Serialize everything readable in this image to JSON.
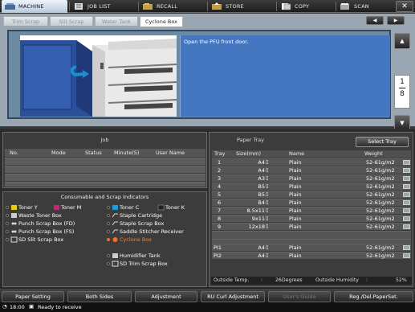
{
  "topnav": {
    "tabs": [
      {
        "label": "MACHINE",
        "icon": "machine-icon"
      },
      {
        "label": "JOB LIST",
        "icon": "job-list-icon"
      },
      {
        "label": "RECALL",
        "icon": "recall-icon"
      },
      {
        "label": "STORE",
        "icon": "store-icon"
      },
      {
        "label": "COPY",
        "icon": "copy-icon"
      },
      {
        "label": "SCAN",
        "icon": "scan-icon"
      }
    ],
    "close_label": "✕"
  },
  "subtabs": [
    "Trim Scrap",
    "Slit Scrap",
    "Water Tank",
    "Cyclone Box"
  ],
  "guide": {
    "message": "Open the PFU front door.",
    "page_current": "1",
    "page_total": "8"
  },
  "job": {
    "title": "Job",
    "columns": [
      "No.",
      "Mode",
      "Status",
      "Minute(S)",
      "User Name"
    ]
  },
  "consumables": {
    "title": "Consumable and Scrap Indicators",
    "items": [
      {
        "label": "Toner Y",
        "color": "#e8d000"
      },
      {
        "label": "Toner M",
        "color": "#d0207a"
      },
      {
        "label": "Toner C",
        "color": "#1aa0d8"
      },
      {
        "label": "Toner K",
        "color": "#111111"
      },
      {
        "label": "Waste Toner Box"
      },
      {
        "label": "Staple Cartridge"
      },
      {
        "label": "Punch Scrap Box (FD)"
      },
      {
        "label": "Staple Scrap Box"
      },
      {
        "label": "Punch Scrap Box (FS)"
      },
      {
        "label": "Saddle Stitcher Receiver"
      },
      {
        "label": "SD Slit Scrap Box"
      },
      {
        "label": "Cyclone Box",
        "warning": true
      },
      {
        "label": "Humidifier Tank"
      },
      {
        "label": "SD Trim Scrap Box"
      }
    ]
  },
  "paper_tray": {
    "title": "Paper Tray",
    "select_label": "Select Tray",
    "columns": [
      "Tray",
      "Size(mm)",
      "Name",
      "Weight"
    ],
    "rows": [
      {
        "tray": "1",
        "size": "A4",
        "name": "Plain",
        "weight": "52-61g/m2"
      },
      {
        "tray": "2",
        "size": "A4",
        "name": "Plain",
        "weight": "52-61g/m2"
      },
      {
        "tray": "3",
        "size": "A3",
        "name": "Plain",
        "weight": "52-61g/m2"
      },
      {
        "tray": "4",
        "size": "B5",
        "name": "Plain",
        "weight": "52-61g/m2"
      },
      {
        "tray": "5",
        "size": "B5",
        "name": "Plain",
        "weight": "52-61g/m2"
      },
      {
        "tray": "6",
        "size": "B4",
        "name": "Plain",
        "weight": "52-61g/m2"
      },
      {
        "tray": "7",
        "size": "8.5x11",
        "name": "Plain",
        "weight": "52-61g/m2"
      },
      {
        "tray": "8",
        "size": "9x11",
        "name": "Plain",
        "weight": "52-61g/m2"
      },
      {
        "tray": "9",
        "size": "12x18",
        "name": "Plain",
        "weight": "52-61g/m2"
      },
      {
        "tray": "PI1",
        "size": "A4",
        "name": "Plain",
        "weight": "52-61g/m2"
      },
      {
        "tray": "PI2",
        "size": "A4",
        "name": "Plain",
        "weight": "52-61g/m2"
      }
    ],
    "outside_temp_label": "Outside Temp.",
    "outside_temp_value": "26Degrees",
    "outside_humidity_label": "Outside Humidity",
    "outside_humidity_value": "52%"
  },
  "bottombar": {
    "buttons": [
      "Paper Setting",
      "Both Sides",
      "Adjustment",
      "RU Curl Adjustment",
      "User's Guide",
      "Reg./Del.PaperSet."
    ]
  },
  "status": {
    "time": "18:00",
    "message": "Ready to receive"
  }
}
